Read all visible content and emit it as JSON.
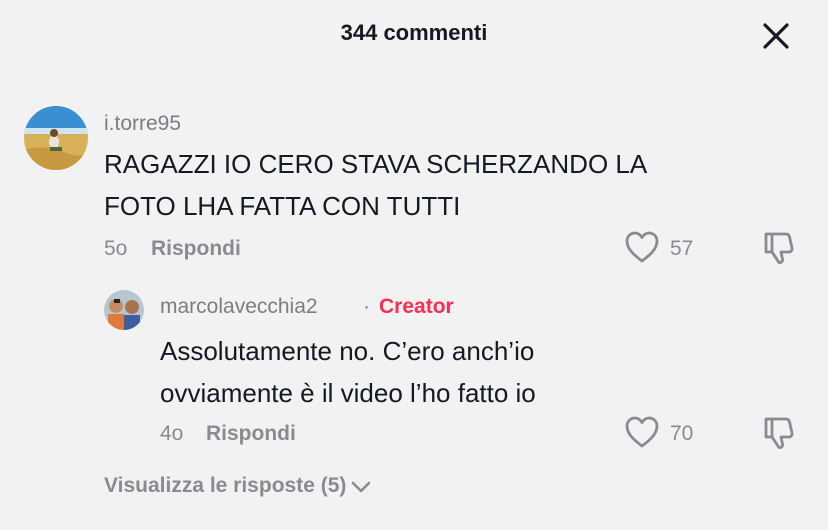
{
  "header": {
    "title": "344 commenti",
    "close_icon": "close-icon"
  },
  "comment": {
    "username": "i.torre95",
    "text_line1": "RAGAZZI IO CERO STAVA SCHERZANDO LA",
    "text_line2": "FOTO LHA FATTA CON TUTTI",
    "time": "5o",
    "reply_label": "Rispondi",
    "likes": "57",
    "icons": [
      "heart-icon",
      "dislike-icon"
    ]
  },
  "reply": {
    "username": "marcolavecchia2",
    "separator": "·",
    "badge": "Creator",
    "badge_color": "#fe2c55",
    "text_line1": "Assolutamente no. C’ero anch’io",
    "text_line2": "ovviamente è il video l’ho fatto io",
    "time": "4o",
    "reply_label": "Rispondi",
    "likes": "70",
    "icons": [
      "heart-icon",
      "dislike-icon"
    ]
  },
  "view_replies": {
    "label": "Visualizza le risposte (5)",
    "icon": "chevron-down-icon"
  },
  "colors": {
    "background": "#f2f2f2",
    "text_primary": "#161823",
    "text_secondary": "#8a8b91",
    "accent": "#fe2c55"
  }
}
